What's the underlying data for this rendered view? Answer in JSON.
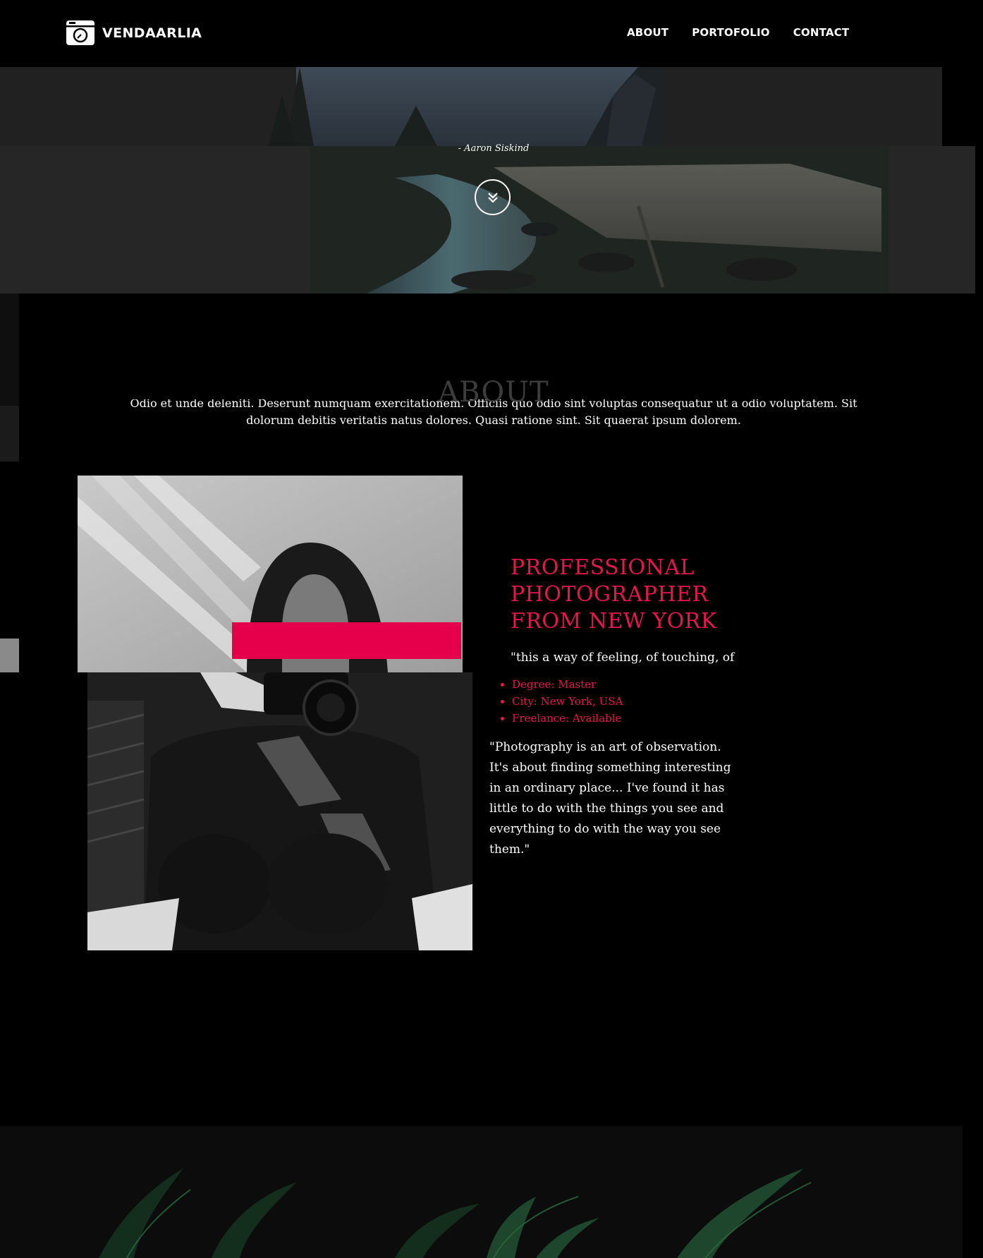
{
  "header": {
    "brand": "VENDAARLIA",
    "logo_icon": "camera-icon",
    "nav": [
      {
        "label": "ABOUT"
      },
      {
        "label": "PORTOFOLIO"
      },
      {
        "label": "CONTACT"
      }
    ]
  },
  "hero": {
    "quote_author": "- Aaron Siskind",
    "scroll_icon": "double-chevron-down-icon"
  },
  "about": {
    "title": "ABOUT",
    "intro": "Odio et unde deleniti. Deserunt numquam exercitationem. Officiis quo odio sint voluptas consequatur ut a odio voluptatem. Sit dolorum debitis veritatis natus dolores. Quasi ratione sint. Sit quaerat ipsum dolorem.",
    "heading": "PROFESSIONAL PHOTOGRAPHER FROM NEW YORK",
    "quote": "\"this a way of feeling, of touching, of",
    "details": [
      "Degree: Master",
      "City: New York, USA",
      "Freelance: Available"
    ],
    "observation": "\"Photography is an art of observation. It's about finding something interesting in an ordinary place... I've found it has little to do with the things you see and everything to do with the way you see them.\""
  },
  "colors": {
    "accent": "#e6174f",
    "background": "#000000",
    "text": "#ffffff"
  }
}
